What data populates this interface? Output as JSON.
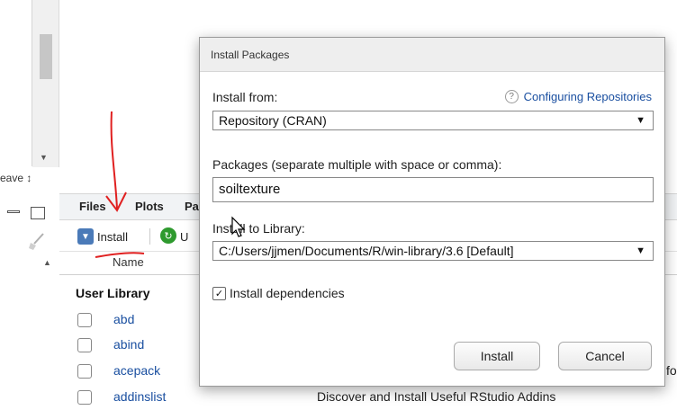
{
  "editor": {
    "weave_label": "eave",
    "weave_arrows": "↕"
  },
  "pane": {
    "tabs": [
      {
        "label": "Files"
      },
      {
        "label": "Plots"
      },
      {
        "label": "Pa"
      }
    ],
    "toolbar": {
      "install_label": "Install",
      "update_fragment": "U"
    },
    "column_name": "Name",
    "section_title": "User Library",
    "packages": [
      {
        "name": "abd",
        "description": ""
      },
      {
        "name": "abind",
        "description": ""
      },
      {
        "name": "acepack",
        "description": ""
      },
      {
        "name": "addinslist",
        "description": "Discover and Install Useful RStudio Addins"
      }
    ],
    "overflow_text": "fo"
  },
  "dialog": {
    "title": "Install Packages",
    "install_from_label": "Install from:",
    "help_link": "Configuring Repositories",
    "install_from_value": "Repository (CRAN)",
    "packages_label": "Packages (separate multiple with space or comma):",
    "packages_value": "soiltexture",
    "library_label": "Install to Library:",
    "library_value": "C:/Users/jjmen/Documents/R/win-library/3.6 [Default]",
    "dependencies_label": "Install dependencies",
    "dependencies_checked": true,
    "install_button": "Install",
    "cancel_button": "Cancel"
  },
  "colors": {
    "link": "#1a4fa0",
    "annotation": "#e02020",
    "update_green": "#2e9a2e"
  }
}
